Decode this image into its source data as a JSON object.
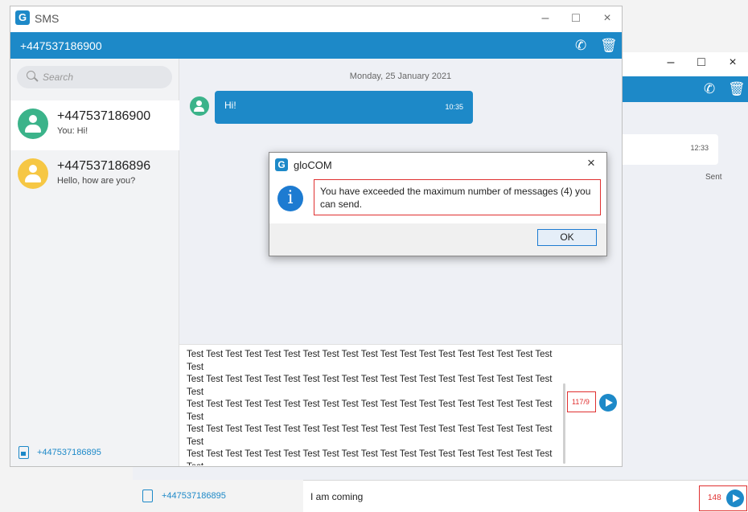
{
  "background_window": {
    "controls": {
      "minimize": "–",
      "maximize": "□",
      "close": "×"
    },
    "message_time": "12:33",
    "message_status": "Sent",
    "footer_number": "+447537186895",
    "input_text": "I am coming",
    "char_count": "148"
  },
  "window": {
    "title": "SMS",
    "app_icon": "G",
    "controls": {
      "minimize": "–",
      "maximize": "□",
      "close": "×"
    }
  },
  "header": {
    "title": "+447537186900",
    "icons": [
      "phone-icon",
      "trash-icon"
    ]
  },
  "sidebar": {
    "search_placeholder": "Search",
    "conversations": [
      {
        "name": "+447537186900",
        "preview": "You: Hi!",
        "avatar_color": "#3bb38a",
        "active": true
      },
      {
        "name": "+447537186896",
        "preview": "Hello, how are you?",
        "avatar_color": "#f6c744",
        "active": false
      }
    ],
    "footer_number": "+447537186895"
  },
  "chat": {
    "date": "Monday, 25 January 2021",
    "messages": [
      {
        "text": "Hi!",
        "time": "10:35"
      }
    ]
  },
  "composer": {
    "text": "Test Test Test Test Test Test Test Test Test Test Test Test Test Test Test Test Test Test Test Test\nTest Test Test Test Test Test Test Test Test Test Test Test Test Test Test Test Test Test Test Test\nTest Test Test Test Test Test Test Test Test Test Test Test Test Test Test Test Test Test Test Test\nTest Test Test Test Test Test Test Test Test Test Test Test Test Test Test Test Test Test Test Test\nTest Test Test Test Test Test Test Test Test Test Test Test Test Test Test Test Test Test Test Test\nTest Test Test Test Test Test Test Test Test Test Test Test Test Test Test Test Test Test Test Test\nTest Test Test Test Test Test Test Test Test Test Test Test Test Test Test Test Test Test Test Test\nTest Test Test Test Test Test Test Test Test Test Test Test Test Test Test Test Test Test Test Test\nTest Test Test Test Test Test Test Test Test Test Test Test Test Test Test Test Test Test Test Test\nTest Test Test Test Test Test Test Test Test Test Test Test Test Test Test Test Test Test Test",
    "char_count": "117/9"
  },
  "dialog": {
    "title": "gloCOM",
    "app_icon": "G",
    "info_icon": "i",
    "close": "×",
    "message": "You have exceeded the maximum number of messages (4) you can send.",
    "ok_label": "OK"
  },
  "colors": {
    "accent": "#1d89c8",
    "alert_red": "#e03030",
    "avatar_green": "#3bb38a",
    "avatar_yellow": "#f6c744"
  }
}
